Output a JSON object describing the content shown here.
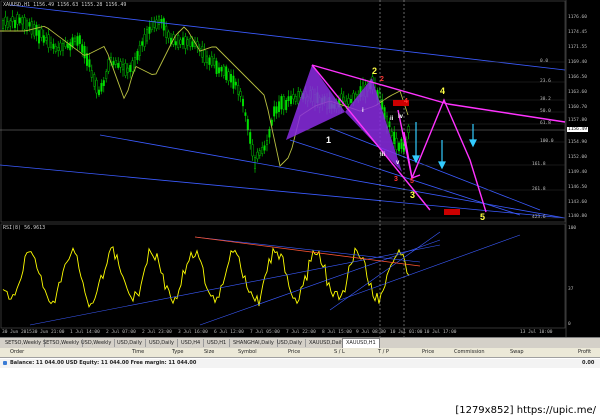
{
  "window": {
    "chart_title": "XAUUSD,H1  1156.49 1156.63 1155.28 1156.49",
    "rsi_title": "RSI(8) 56.9613"
  },
  "price_axis": [
    "1176.60",
    "1174.45",
    "1171.55",
    "1169.40",
    "1166.50",
    "1163.60",
    "1160.70",
    "1157.80",
    "1154.90",
    "1152.00",
    "1149.40",
    "1146.50",
    "1143.60",
    "1140.80"
  ],
  "current_price": "1156.49",
  "rsi_axis": [
    "100",
    "37",
    "0"
  ],
  "time_axis": [
    "30 Jun 2015",
    "30 Jun 21:00",
    "1 Jul 14:00",
    "2 Jul 07:00",
    "2 Jul 23:00",
    "3 Jul 16:00",
    "6 Jul 12:00",
    "7 Jul 05:00",
    "7 Jul 22:00",
    "8 Jul 15:00",
    "9 Jul 08:00",
    "10 Jul 01:00",
    "10 Jul 17:00",
    "13 Jul 10:00"
  ],
  "fib_labels": [
    "0.0",
    "23.6",
    "38.2",
    "50.0",
    "61.8",
    "100.0",
    "161.8",
    "261.8",
    "423.6"
  ],
  "wave_labels": {
    "w1": "1",
    "w2": "2",
    "w3": "3",
    "w4": "4",
    "w5": "5",
    "sub_i": "i",
    "sub_ii": "ii",
    "sub_iii": "iii",
    "sub_iv": "iv",
    "sub_v": "v",
    "r2": "2",
    "r3": "3",
    "r4": "4",
    "r5": "5"
  },
  "tabs": [
    {
      "label": "SETSO,Weekly",
      "active": false
    },
    {
      "label": "SETSO,Weekly",
      "active": false
    },
    {
      "label": "USD,Weekly",
      "active": false
    },
    {
      "label": "USD,Daily",
      "active": false
    },
    {
      "label": "USD,Daily",
      "active": false
    },
    {
      "label": "USD,H4",
      "active": false
    },
    {
      "label": "USD,H1",
      "active": false
    },
    {
      "label": "SHANGHAI,Daily",
      "active": false
    },
    {
      "label": "USD,Daily",
      "active": false
    },
    {
      "label": "XAUUSD,Daily",
      "active": false
    },
    {
      "label": "XAUUSD,H1",
      "active": true
    }
  ],
  "terminal": {
    "columns": [
      "Order",
      "Time",
      "Type",
      "Size",
      "Symbol",
      "Price",
      "S / L",
      "T / P",
      "Price",
      "Commission",
      "Swap",
      "Profit"
    ],
    "balance_text": "Balance: 11 044.00 USD  Equity: 11 044.00  Free margin: 11 044.00",
    "profit_value": "0.00"
  },
  "watermark": "[1279x852] https://upic.me/",
  "colors": {
    "bull": "#00e000",
    "bear": "#00e000",
    "ma": "#b8c040",
    "pattern_fill": "#8a2be2",
    "wave": "#ff33ff",
    "rsi": "#ffff00",
    "channel": "#4060ff",
    "arrow_cyan": "#33ccff"
  }
}
